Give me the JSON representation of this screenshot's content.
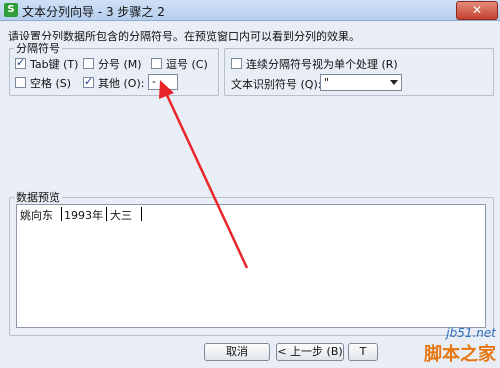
{
  "window": {
    "title": "文本分列向导 - 3 步骤之 2",
    "app_icon_glyph": "S",
    "close_glyph": "✕"
  },
  "instruction": "请设置分列数据所包含的分隔符号。在预览窗口内可以看到分列的效果。",
  "delimiters": {
    "group_label": "分隔符号",
    "tab": {
      "label": "Tab键 (T)",
      "checked": true
    },
    "semicolon": {
      "label": "分号 (M)",
      "checked": false
    },
    "comma": {
      "label": "逗号 (C)",
      "checked": false
    },
    "space": {
      "label": "空格 (S)",
      "checked": false
    },
    "other": {
      "label": "其他 (O):",
      "checked": true,
      "value": "-"
    }
  },
  "options": {
    "consecutive": {
      "label": "连续分隔符号视为单个处理 (R)",
      "checked": false
    },
    "text_qualifier": {
      "label": "文本识别符号 (Q):",
      "value": "\""
    }
  },
  "preview": {
    "group_label": "数据预览",
    "columns": [
      "姚向东",
      "1993年",
      "大三"
    ]
  },
  "buttons": {
    "cancel": "取消",
    "back": "< 上一步 (B)",
    "next_partial": "T"
  },
  "watermark": {
    "line1": "jb51.net",
    "line2": "脚本之家"
  },
  "colors": {
    "annotation_arrow": "#e8262a",
    "dialog_bg": "#e9eef6"
  }
}
